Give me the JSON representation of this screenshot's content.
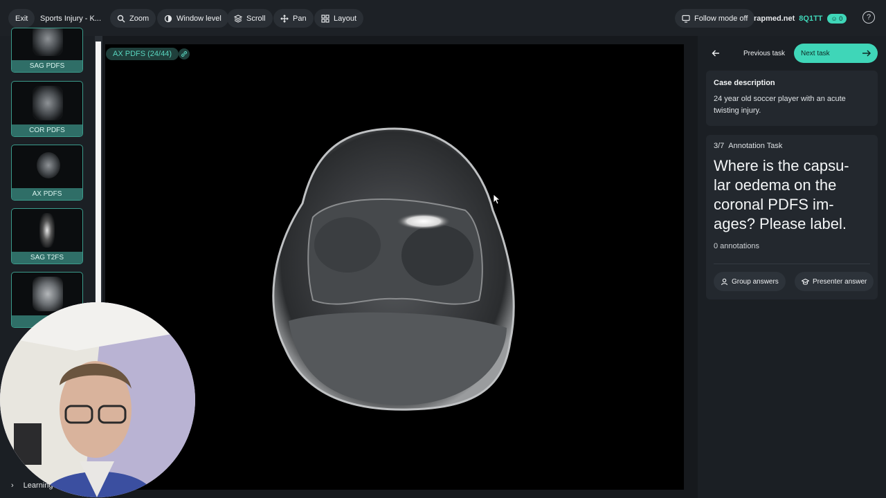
{
  "topbar": {
    "exit_label": "Exit",
    "case_title": "Sports Injury - K...",
    "tools": [
      "Zoom",
      "Window level",
      "Scroll",
      "Pan",
      "Layout"
    ],
    "follow_mode_label": "Follow mode off",
    "site": "rapmed.net",
    "session_code": "8Q1TT",
    "participants_count": "0",
    "help_label": "?"
  },
  "series_panel": {
    "items": [
      {
        "label": "SAG PDFS"
      },
      {
        "label": "COR PDFS"
      },
      {
        "label": "AX PDFS"
      },
      {
        "label": "SAG T2FS"
      },
      {
        "label": "C"
      }
    ]
  },
  "viewer": {
    "series_tag": "AX PDFS  (24/44)"
  },
  "nav": {
    "previous_label": "Previous task",
    "next_label": "Next task"
  },
  "case": {
    "title": "Case description",
    "description": "24 year old soccer player with an acute twisting injury."
  },
  "task": {
    "progress": "3/7",
    "type": "Annotation Task",
    "question": "Where is the capsu-lar oedema on the coronal PDFS im-ages? Please label.",
    "annotations": "0 annotations",
    "group_answers_label": "Group answers",
    "presenter_answer_label": "Presenter answer"
  },
  "bottom": {
    "learning_label": "Learning"
  },
  "colors": {
    "accent": "#3fd6b8",
    "background": "#1b1f24",
    "thumb_label": "#2f6e67"
  }
}
